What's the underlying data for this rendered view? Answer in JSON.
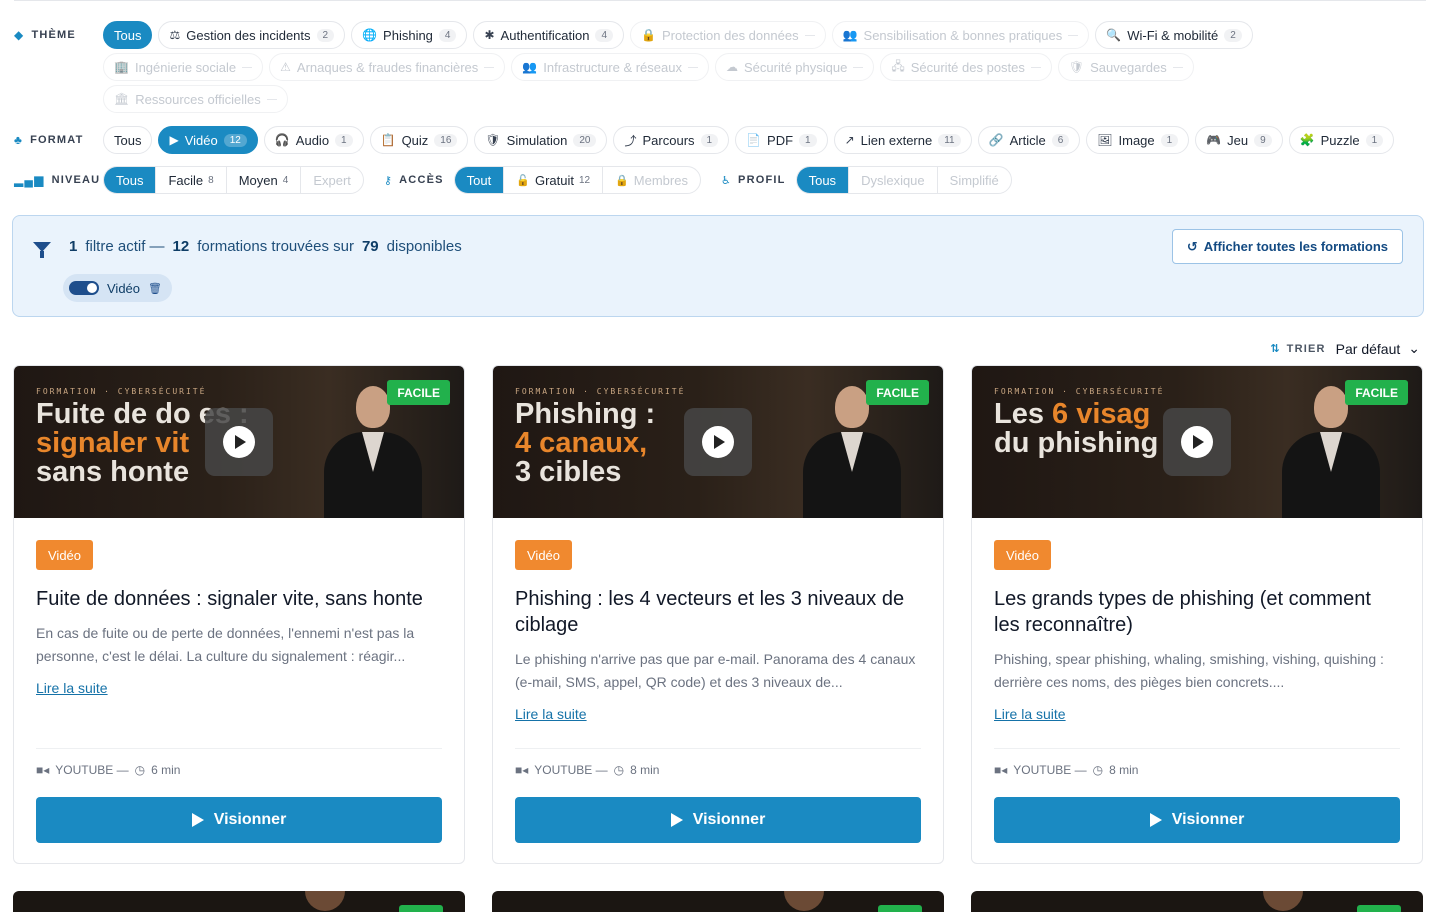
{
  "filters": {
    "theme": {
      "label": "THÈME",
      "chips": [
        {
          "label": "Tous",
          "icon": "",
          "count": "",
          "state": "active"
        },
        {
          "label": "Gestion des incidents",
          "icon": "⚖",
          "count": "2",
          "state": "normal"
        },
        {
          "label": "Phishing",
          "icon": "🌐",
          "count": "4",
          "state": "normal"
        },
        {
          "label": "Authentification",
          "icon": "✱",
          "count": "4",
          "state": "normal"
        },
        {
          "label": "Protection des données",
          "icon": "🔒",
          "count": "",
          "state": "disabled"
        },
        {
          "label": "Sensibilisation & bonnes pratiques",
          "icon": "👥",
          "count": "",
          "state": "disabled"
        },
        {
          "label": "Wi-Fi & mobilité",
          "icon": "🔍",
          "count": "2",
          "state": "normal"
        },
        {
          "label": "Ingénierie sociale",
          "icon": "🏢",
          "count": "",
          "state": "disabled"
        },
        {
          "label": "Arnaques & fraudes financières",
          "icon": "⚠",
          "count": "",
          "state": "disabled"
        },
        {
          "label": "Infrastructure & réseaux",
          "icon": "👥",
          "count": "",
          "state": "disabled"
        },
        {
          "label": "Sécurité physique",
          "icon": "☁",
          "count": "",
          "state": "disabled"
        },
        {
          "label": "Sécurité des postes",
          "icon": "🖧",
          "count": "",
          "state": "disabled"
        },
        {
          "label": "Sauvegardes",
          "icon": "🛡",
          "count": "",
          "state": "disabled"
        },
        {
          "label": "Ressources officielles",
          "icon": "🏛",
          "count": "",
          "state": "disabled"
        }
      ]
    },
    "format": {
      "label": "FORMAT",
      "chips": [
        {
          "label": "Tous",
          "icon": "",
          "count": "",
          "state": "normal"
        },
        {
          "label": "Vidéo",
          "icon": "▶",
          "count": "12",
          "state": "active"
        },
        {
          "label": "Audio",
          "icon": "🎧",
          "count": "1",
          "state": "normal"
        },
        {
          "label": "Quiz",
          "icon": "📋",
          "count": "16",
          "state": "normal"
        },
        {
          "label": "Simulation",
          "icon": "🛡",
          "count": "20",
          "state": "normal"
        },
        {
          "label": "Parcours",
          "icon": "⤴",
          "count": "1",
          "state": "normal"
        },
        {
          "label": "PDF",
          "icon": "📄",
          "count": "1",
          "state": "normal"
        },
        {
          "label": "Lien externe",
          "icon": "↗",
          "count": "11",
          "state": "normal"
        },
        {
          "label": "Article",
          "icon": "🔗",
          "count": "6",
          "state": "normal"
        },
        {
          "label": "Image",
          "icon": "🖼",
          "count": "1",
          "state": "normal"
        },
        {
          "label": "Jeu",
          "icon": "🎮",
          "count": "9",
          "state": "normal"
        },
        {
          "label": "Puzzle",
          "icon": "🧩",
          "count": "1",
          "state": "normal"
        }
      ]
    },
    "niveau": {
      "label": "NIVEAU",
      "options": [
        {
          "label": "Tous",
          "count": "",
          "state": "active"
        },
        {
          "label": "Facile",
          "count": "8",
          "state": "normal"
        },
        {
          "label": "Moyen",
          "count": "4",
          "state": "normal"
        },
        {
          "label": "Expert",
          "count": "",
          "state": "disabled"
        }
      ]
    },
    "acces": {
      "label": "ACCÈS",
      "options": [
        {
          "label": "Tout",
          "count": "",
          "icon": "",
          "state": "active"
        },
        {
          "label": "Gratuit",
          "count": "12",
          "icon": "🔓",
          "state": "normal"
        },
        {
          "label": "Membres",
          "count": "",
          "icon": "🔒",
          "state": "disabled"
        }
      ]
    },
    "profil": {
      "label": "PROFIL",
      "options": [
        {
          "label": "Tous",
          "count": "",
          "state": "active"
        },
        {
          "label": "Dyslexique",
          "count": "",
          "state": "disabled"
        },
        {
          "label": "Simplifié",
          "count": "",
          "state": "disabled"
        }
      ]
    }
  },
  "summary": {
    "active_count": "1",
    "active_text": "filtre actif —",
    "found_count": "12",
    "found_text": "formations trouvées sur",
    "total": "79",
    "total_text": "disponibles",
    "active_pill": "Vidéo",
    "reset_label": "Afficher toutes les formations"
  },
  "sort": {
    "label": "TRIER",
    "value": "Par défaut"
  },
  "cards": [
    {
      "kicker": "FORMATION · CYBERSÉCURITÉ",
      "thumb_line1": "Fuite de do",
      "thumb_line1b": "es :",
      "thumb_line2": "signaler vit",
      "thumb_line3": "sans honte",
      "level": "FACILE",
      "type": "Vidéo",
      "title": "Fuite de données : signaler vite, sans honte",
      "desc": "En cas de fuite ou de perte de données, l'ennemi n'est pas la personne, c'est le délai. La culture du signalement : réagir...",
      "more": "Lire la suite",
      "source": "YOUTUBE —",
      "duration": "6 min",
      "cta": "Visionner"
    },
    {
      "kicker": "FORMATION · CYBERSÉCURITÉ",
      "thumb_line1": "Phishing :",
      "thumb_line1b": "",
      "thumb_line2": "4 canaux,",
      "thumb_line3": "3 cibles",
      "level": "FACILE",
      "type": "Vidéo",
      "title": "Phishing : les 4 vecteurs et les 3 niveaux de ciblage",
      "desc": "Le phishing n'arrive pas que par e-mail. Panorama des 4 canaux (e-mail, SMS, appel, QR code) et des 3 niveaux de...",
      "more": "Lire la suite",
      "source": "YOUTUBE —",
      "duration": "8 min",
      "cta": "Visionner"
    },
    {
      "kicker": "FORMATION · CYBERSÉCURITÉ",
      "thumb_line1": "Les",
      "thumb_line1b": "6 visag",
      "thumb_line2": "",
      "thumb_line3": "du phishing",
      "level": "FACILE",
      "type": "Vidéo",
      "title": "Les grands types de phishing (et comment les reconnaître)",
      "desc": "Phishing, spear phishing, whaling, smishing, vishing, quishing : derrière ces noms, des pièges bien concrets....",
      "more": "Lire la suite",
      "source": "YOUTUBE —",
      "duration": "8 min",
      "cta": "Visionner"
    }
  ],
  "colors": {
    "primary": "#1a8ac2",
    "video_badge": "#f0892f",
    "level_badge": "#22b14c"
  }
}
